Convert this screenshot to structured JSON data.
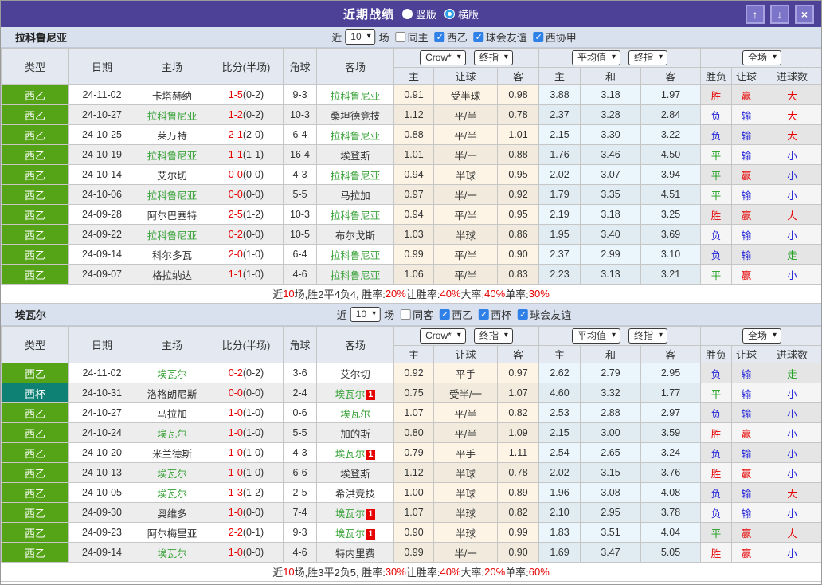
{
  "title_bar": {
    "title": "近期战绩",
    "radios": [
      {
        "label": "竖版",
        "style": "filled"
      },
      {
        "label": "横版",
        "style": "ring"
      }
    ],
    "buttons": [
      {
        "icon": "up-arrow"
      },
      {
        "icon": "down-arrow"
      },
      {
        "icon": "close"
      }
    ]
  },
  "colors": {
    "titlebar_bg": "#4c4197",
    "checkbox_blue": "#2f81e8",
    "team_green": "#3aa33a",
    "score_red": "#e60000",
    "league_colors": {
      "西乙": "#55a317",
      "西杯": "#0e8174"
    },
    "result_red": "#e60000",
    "result_blue": "#2424d8",
    "result_green": "#1e9e1e"
  },
  "header_template": {
    "left_cols": [
      "类型",
      "日期",
      "主场",
      "比分(半场)",
      "角球",
      "客场"
    ],
    "dropdown_groups": [
      [
        "Crow*",
        "终指"
      ],
      [
        "平均值",
        "终指"
      ],
      [
        "全场"
      ]
    ],
    "sub_cols": [
      "主",
      "让球",
      "客",
      "主",
      "和",
      "客",
      "胜负",
      "让球",
      "进球数"
    ]
  },
  "sections": [
    {
      "team": "拉科鲁尼亚",
      "filter": {
        "prefix": "近",
        "count": "10",
        "suffix": "场",
        "checkboxes": [
          {
            "label": "同主",
            "checked": false
          },
          {
            "label": "西乙",
            "checked": true
          },
          {
            "label": "球会友谊",
            "checked": true
          },
          {
            "label": "西协甲",
            "checked": true
          }
        ]
      },
      "rows": [
        {
          "type": "西乙",
          "date": "24-11-02",
          "home": {
            "text": "卡塔赫纳",
            "team": false
          },
          "score": "1-5",
          "half": "(0-2)",
          "corner": "9-3",
          "away": {
            "text": "拉科鲁尼亚",
            "team": true
          },
          "odds": [
            "0.91",
            "受半球",
            "0.98"
          ],
          "avg": [
            "3.88",
            "3.18",
            "1.97"
          ],
          "results": [
            {
              "t": "胜",
              "c": "r"
            },
            {
              "t": "赢",
              "c": "r"
            },
            {
              "t": "大",
              "c": "r"
            }
          ]
        },
        {
          "type": "西乙",
          "date": "24-10-27",
          "home": {
            "text": "拉科鲁尼亚",
            "team": true
          },
          "score": "1-2",
          "half": "(0-2)",
          "corner": "10-3",
          "away": {
            "text": "桑坦德竞技",
            "team": false
          },
          "odds": [
            "1.12",
            "平/半",
            "0.78"
          ],
          "avg": [
            "2.37",
            "3.28",
            "2.84"
          ],
          "results": [
            {
              "t": "负",
              "c": "b"
            },
            {
              "t": "输",
              "c": "b"
            },
            {
              "t": "大",
              "c": "r"
            }
          ]
        },
        {
          "type": "西乙",
          "date": "24-10-25",
          "home": {
            "text": "莱万特",
            "team": false
          },
          "score": "2-1",
          "half": "(2-0)",
          "corner": "6-4",
          "away": {
            "text": "拉科鲁尼亚",
            "team": true
          },
          "odds": [
            "0.88",
            "平/半",
            "1.01"
          ],
          "avg": [
            "2.15",
            "3.30",
            "3.22"
          ],
          "results": [
            {
              "t": "负",
              "c": "b"
            },
            {
              "t": "输",
              "c": "b"
            },
            {
              "t": "大",
              "c": "r"
            }
          ]
        },
        {
          "type": "西乙",
          "date": "24-10-19",
          "home": {
            "text": "拉科鲁尼亚",
            "team": true
          },
          "score": "1-1",
          "half": "(1-1)",
          "corner": "16-4",
          "away": {
            "text": "埃登斯",
            "team": false
          },
          "odds": [
            "1.01",
            "半/一",
            "0.88"
          ],
          "avg": [
            "1.76",
            "3.46",
            "4.50"
          ],
          "results": [
            {
              "t": "平",
              "c": "g"
            },
            {
              "t": "输",
              "c": "b"
            },
            {
              "t": "小",
              "c": "b"
            }
          ]
        },
        {
          "type": "西乙",
          "date": "24-10-14",
          "home": {
            "text": "艾尔切",
            "team": false
          },
          "score": "0-0",
          "half": "(0-0)",
          "corner": "4-3",
          "away": {
            "text": "拉科鲁尼亚",
            "team": true
          },
          "odds": [
            "0.94",
            "半球",
            "0.95"
          ],
          "avg": [
            "2.02",
            "3.07",
            "3.94"
          ],
          "results": [
            {
              "t": "平",
              "c": "g"
            },
            {
              "t": "赢",
              "c": "r"
            },
            {
              "t": "小",
              "c": "b"
            }
          ]
        },
        {
          "type": "西乙",
          "date": "24-10-06",
          "home": {
            "text": "拉科鲁尼亚",
            "team": true
          },
          "score": "0-0",
          "half": "(0-0)",
          "corner": "5-5",
          "away": {
            "text": "马拉加",
            "team": false
          },
          "odds": [
            "0.97",
            "半/一",
            "0.92"
          ],
          "avg": [
            "1.79",
            "3.35",
            "4.51"
          ],
          "results": [
            {
              "t": "平",
              "c": "g"
            },
            {
              "t": "输",
              "c": "b"
            },
            {
              "t": "小",
              "c": "b"
            }
          ]
        },
        {
          "type": "西乙",
          "date": "24-09-28",
          "home": {
            "text": "阿尔巴塞特",
            "team": false
          },
          "score": "2-5",
          "half": "(1-2)",
          "corner": "10-3",
          "away": {
            "text": "拉科鲁尼亚",
            "team": true
          },
          "odds": [
            "0.94",
            "平/半",
            "0.95"
          ],
          "avg": [
            "2.19",
            "3.18",
            "3.25"
          ],
          "results": [
            {
              "t": "胜",
              "c": "r"
            },
            {
              "t": "赢",
              "c": "r"
            },
            {
              "t": "大",
              "c": "r"
            }
          ]
        },
        {
          "type": "西乙",
          "date": "24-09-22",
          "home": {
            "text": "拉科鲁尼亚",
            "team": true
          },
          "score": "0-2",
          "half": "(0-0)",
          "corner": "10-5",
          "away": {
            "text": "布尔戈斯",
            "team": false
          },
          "odds": [
            "1.03",
            "半球",
            "0.86"
          ],
          "avg": [
            "1.95",
            "3.40",
            "3.69"
          ],
          "results": [
            {
              "t": "负",
              "c": "b"
            },
            {
              "t": "输",
              "c": "b"
            },
            {
              "t": "小",
              "c": "b"
            }
          ]
        },
        {
          "type": "西乙",
          "date": "24-09-14",
          "home": {
            "text": "科尔多瓦",
            "team": false
          },
          "score": "2-0",
          "half": "(1-0)",
          "corner": "6-4",
          "away": {
            "text": "拉科鲁尼亚",
            "team": true
          },
          "odds": [
            "0.99",
            "平/半",
            "0.90"
          ],
          "avg": [
            "2.37",
            "2.99",
            "3.10"
          ],
          "results": [
            {
              "t": "负",
              "c": "b"
            },
            {
              "t": "输",
              "c": "b"
            },
            {
              "t": "走",
              "c": "g"
            }
          ]
        },
        {
          "type": "西乙",
          "date": "24-09-07",
          "home": {
            "text": "格拉纳达",
            "team": false
          },
          "score": "1-1",
          "half": "(1-0)",
          "corner": "4-6",
          "away": {
            "text": "拉科鲁尼亚",
            "team": true
          },
          "odds": [
            "1.06",
            "平/半",
            "0.83"
          ],
          "avg": [
            "2.23",
            "3.13",
            "3.21"
          ],
          "results": [
            {
              "t": "平",
              "c": "g"
            },
            {
              "t": "赢",
              "c": "r"
            },
            {
              "t": "小",
              "c": "b"
            }
          ]
        }
      ],
      "summary": [
        {
          "t": "近",
          "c": "d"
        },
        {
          "t": "10",
          "c": "r"
        },
        {
          "t": "场,胜2平4负4, 胜率:",
          "c": "d"
        },
        {
          "t": "20%",
          "c": "r"
        },
        {
          "t": " 让胜率:",
          "c": "d"
        },
        {
          "t": "40%",
          "c": "r"
        },
        {
          "t": " 大率:",
          "c": "d"
        },
        {
          "t": "40%",
          "c": "r"
        },
        {
          "t": " 单率:",
          "c": "d"
        },
        {
          "t": "30%",
          "c": "r"
        }
      ]
    },
    {
      "team": "埃瓦尔",
      "filter": {
        "prefix": "近",
        "count": "10",
        "suffix": "场",
        "checkboxes": [
          {
            "label": "同客",
            "checked": false
          },
          {
            "label": "西乙",
            "checked": true
          },
          {
            "label": "西杯",
            "checked": true
          },
          {
            "label": "球会友谊",
            "checked": true
          }
        ]
      },
      "rows": [
        {
          "type": "西乙",
          "date": "24-11-02",
          "home": {
            "text": "埃瓦尔",
            "team": true
          },
          "score": "0-2",
          "half": "(0-2)",
          "corner": "3-6",
          "away": {
            "text": "艾尔切",
            "team": false
          },
          "odds": [
            "0.92",
            "平手",
            "0.97"
          ],
          "avg": [
            "2.62",
            "2.79",
            "2.95"
          ],
          "results": [
            {
              "t": "负",
              "c": "b"
            },
            {
              "t": "输",
              "c": "b"
            },
            {
              "t": "走",
              "c": "g"
            }
          ]
        },
        {
          "type": "西杯",
          "date": "24-10-31",
          "home": {
            "text": "洛格朗尼斯",
            "team": false
          },
          "score": "0-0",
          "half": "(0-0)",
          "corner": "2-4",
          "away": {
            "text": "埃瓦尔",
            "team": true,
            "red_card": "1"
          },
          "odds": [
            "0.75",
            "受半/一",
            "1.07"
          ],
          "avg": [
            "4.60",
            "3.32",
            "1.77"
          ],
          "results": [
            {
              "t": "平",
              "c": "g"
            },
            {
              "t": "输",
              "c": "b"
            },
            {
              "t": "小",
              "c": "b"
            }
          ]
        },
        {
          "type": "西乙",
          "date": "24-10-27",
          "home": {
            "text": "马拉加",
            "team": false
          },
          "score": "1-0",
          "half": "(1-0)",
          "corner": "0-6",
          "away": {
            "text": "埃瓦尔",
            "team": true
          },
          "odds": [
            "1.07",
            "平/半",
            "0.82"
          ],
          "avg": [
            "2.53",
            "2.88",
            "2.97"
          ],
          "results": [
            {
              "t": "负",
              "c": "b"
            },
            {
              "t": "输",
              "c": "b"
            },
            {
              "t": "小",
              "c": "b"
            }
          ]
        },
        {
          "type": "西乙",
          "date": "24-10-24",
          "home": {
            "text": "埃瓦尔",
            "team": true
          },
          "score": "1-0",
          "half": "(1-0)",
          "corner": "5-5",
          "away": {
            "text": "加的斯",
            "team": false
          },
          "odds": [
            "0.80",
            "平/半",
            "1.09"
          ],
          "avg": [
            "2.15",
            "3.00",
            "3.59"
          ],
          "results": [
            {
              "t": "胜",
              "c": "r"
            },
            {
              "t": "赢",
              "c": "r"
            },
            {
              "t": "小",
              "c": "b"
            }
          ]
        },
        {
          "type": "西乙",
          "date": "24-10-20",
          "home": {
            "text": "米兰德斯",
            "team": false
          },
          "score": "1-0",
          "half": "(1-0)",
          "corner": "4-3",
          "away": {
            "text": "埃瓦尔",
            "team": true,
            "red_card": "1"
          },
          "odds": [
            "0.79",
            "平手",
            "1.11"
          ],
          "avg": [
            "2.54",
            "2.65",
            "3.24"
          ],
          "results": [
            {
              "t": "负",
              "c": "b"
            },
            {
              "t": "输",
              "c": "b"
            },
            {
              "t": "小",
              "c": "b"
            }
          ]
        },
        {
          "type": "西乙",
          "date": "24-10-13",
          "home": {
            "text": "埃瓦尔",
            "team": true
          },
          "score": "1-0",
          "half": "(1-0)",
          "corner": "6-6",
          "away": {
            "text": "埃登斯",
            "team": false
          },
          "odds": [
            "1.12",
            "半球",
            "0.78"
          ],
          "avg": [
            "2.02",
            "3.15",
            "3.76"
          ],
          "results": [
            {
              "t": "胜",
              "c": "r"
            },
            {
              "t": "赢",
              "c": "r"
            },
            {
              "t": "小",
              "c": "b"
            }
          ]
        },
        {
          "type": "西乙",
          "date": "24-10-05",
          "home": {
            "text": "埃瓦尔",
            "team": true
          },
          "score": "1-3",
          "half": "(1-2)",
          "corner": "2-5",
          "away": {
            "text": "希洪竞技",
            "team": false
          },
          "odds": [
            "1.00",
            "半球",
            "0.89"
          ],
          "avg": [
            "1.96",
            "3.08",
            "4.08"
          ],
          "results": [
            {
              "t": "负",
              "c": "b"
            },
            {
              "t": "输",
              "c": "b"
            },
            {
              "t": "大",
              "c": "r"
            }
          ]
        },
        {
          "type": "西乙",
          "date": "24-09-30",
          "home": {
            "text": "奥维多",
            "team": false
          },
          "score": "1-0",
          "half": "(0-0)",
          "corner": "7-4",
          "away": {
            "text": "埃瓦尔",
            "team": true,
            "red_card": "1"
          },
          "odds": [
            "1.07",
            "半球",
            "0.82"
          ],
          "avg": [
            "2.10",
            "2.95",
            "3.78"
          ],
          "results": [
            {
              "t": "负",
              "c": "b"
            },
            {
              "t": "输",
              "c": "b"
            },
            {
              "t": "小",
              "c": "b"
            }
          ]
        },
        {
          "type": "西乙",
          "date": "24-09-23",
          "home": {
            "text": "阿尔梅里亚",
            "team": false
          },
          "score": "2-2",
          "half": "(0-1)",
          "corner": "9-3",
          "away": {
            "text": "埃瓦尔",
            "team": true,
            "red_card": "1"
          },
          "odds": [
            "0.90",
            "半球",
            "0.99"
          ],
          "avg": [
            "1.83",
            "3.51",
            "4.04"
          ],
          "results": [
            {
              "t": "平",
              "c": "g"
            },
            {
              "t": "赢",
              "c": "r"
            },
            {
              "t": "大",
              "c": "r"
            }
          ]
        },
        {
          "type": "西乙",
          "date": "24-09-14",
          "home": {
            "text": "埃瓦尔",
            "team": true
          },
          "score": "1-0",
          "half": "(0-0)",
          "corner": "4-6",
          "away": {
            "text": "特内里费",
            "team": false
          },
          "odds": [
            "0.99",
            "半/一",
            "0.90"
          ],
          "avg": [
            "1.69",
            "3.47",
            "5.05"
          ],
          "results": [
            {
              "t": "胜",
              "c": "r"
            },
            {
              "t": "赢",
              "c": "r"
            },
            {
              "t": "小",
              "c": "b"
            }
          ]
        }
      ],
      "summary": [
        {
          "t": "近",
          "c": "d"
        },
        {
          "t": "10",
          "c": "r"
        },
        {
          "t": "场,胜3平2负5, 胜率:",
          "c": "d"
        },
        {
          "t": "30%",
          "c": "r"
        },
        {
          "t": " 让胜率:",
          "c": "d"
        },
        {
          "t": "40%",
          "c": "r"
        },
        {
          "t": " 大率:",
          "c": "d"
        },
        {
          "t": "20%",
          "c": "r"
        },
        {
          "t": " 单率:",
          "c": "d"
        },
        {
          "t": "60%",
          "c": "r"
        }
      ]
    }
  ]
}
